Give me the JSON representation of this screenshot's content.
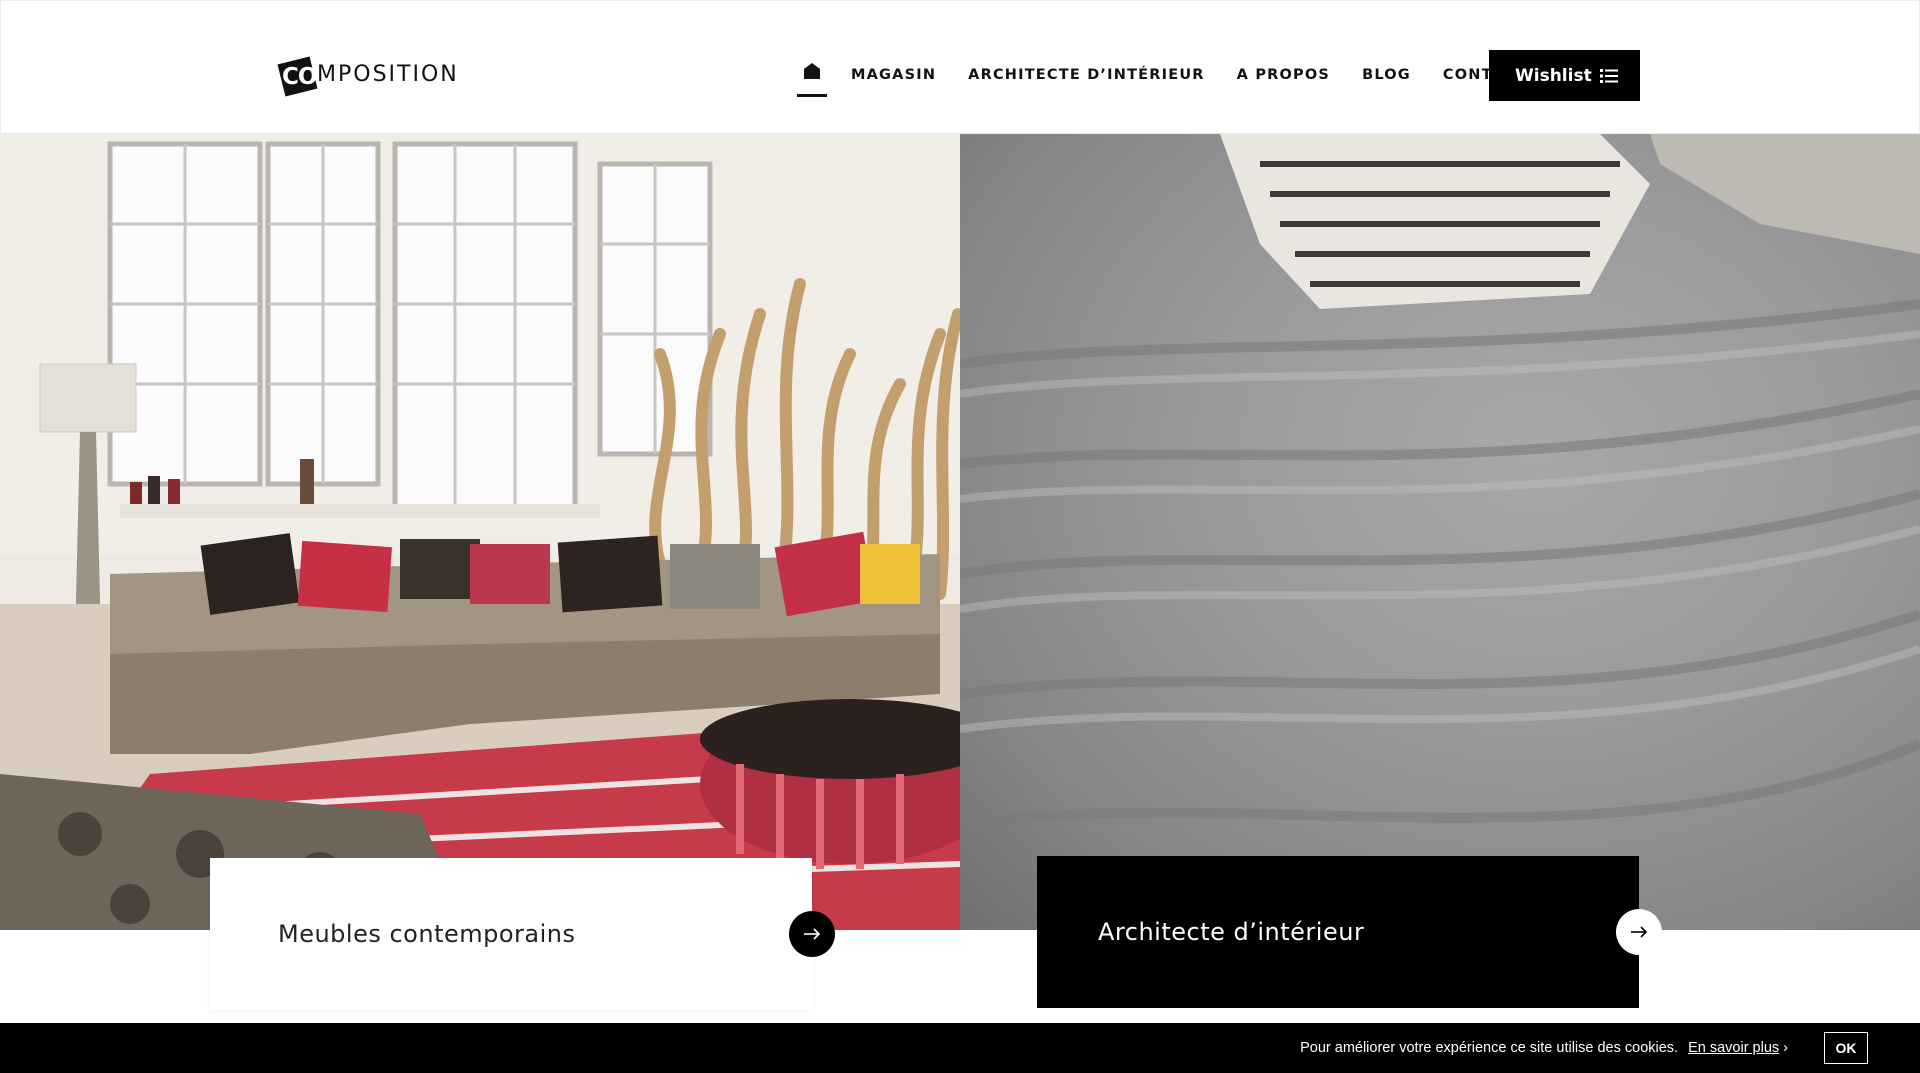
{
  "brand": {
    "logo_mark": "CO",
    "logo_text": "MPOSITION"
  },
  "nav": {
    "home_icon": "home-icon",
    "items": [
      {
        "label": "MAGASIN"
      },
      {
        "label": "ARCHITECTE D’INTÉRIEUR"
      },
      {
        "label": "A PROPOS"
      },
      {
        "label": "BLOG"
      },
      {
        "label": "CONTACT"
      }
    ]
  },
  "wishlist": {
    "label": "Wishlist",
    "icon": "list-icon"
  },
  "hero": {
    "left_image": "living-room-sofa-photo",
    "right_image": "grey-tufted-sofa-closeup-photo"
  },
  "cards": {
    "left": {
      "title": "Meubles contemporains",
      "icon": "arrow-right-icon"
    },
    "right": {
      "title": "Architecte d’intérieur",
      "icon": "arrow-right-icon"
    }
  },
  "cookie": {
    "message": "Pour améliorer votre expérience ce site utilise des cookies.",
    "link_label": "En savoir plus",
    "link_arrow": "›",
    "ok_label": "OK"
  },
  "colors": {
    "accent": "#000000",
    "background": "#ffffff",
    "text": "#111111"
  }
}
